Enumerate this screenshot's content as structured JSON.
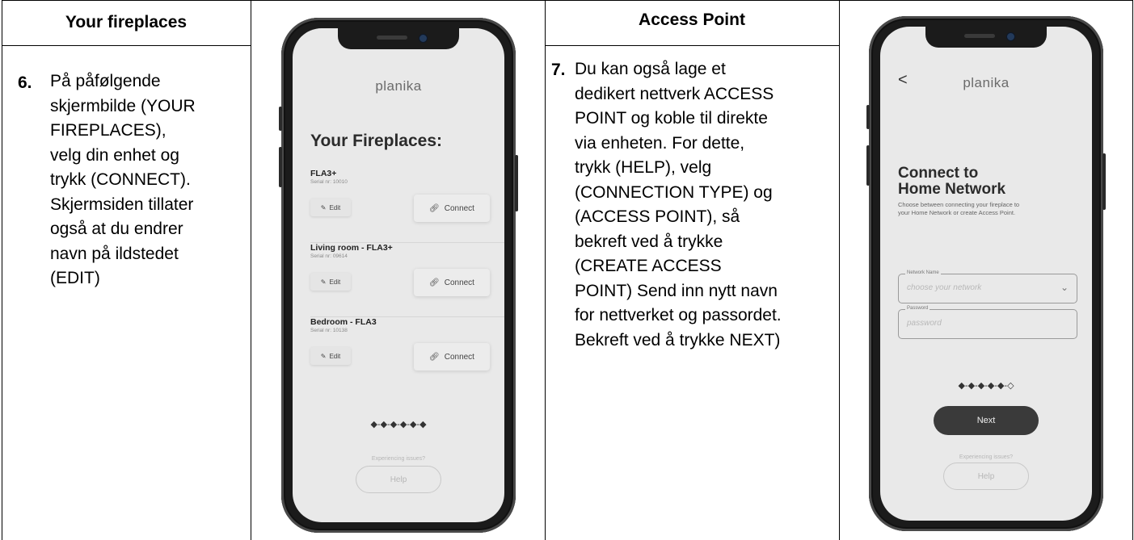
{
  "col1": {
    "header": "Your fireplaces",
    "number": "6.",
    "lines": [
      "På påfølgende",
      "skjermbilde (YOUR",
      "FIREPLACES),",
      "velg din enhet og",
      "trykk (CONNECT).",
      "Skjermsiden tillater",
      "også at du endrer",
      "navn på ildstedet",
      "(EDIT)"
    ]
  },
  "phone1": {
    "brand": "planika",
    "title": "Your Fireplaces:",
    "items": [
      {
        "name": "FLA3+",
        "serial": "Serial nr: 10010",
        "edit": "Edit",
        "connect": "Connect"
      },
      {
        "name": "Living room - FLA3+",
        "serial": "Serial nr: 09614",
        "edit": "Edit",
        "connect": "Connect"
      },
      {
        "name": "Bedroom - FLA3",
        "serial": "Serial nr: 10138",
        "edit": "Edit",
        "connect": "Connect"
      }
    ],
    "progress": "◆-◆-◆-◆-◆-◆",
    "issues": "Experiencing issues?",
    "help": "Help"
  },
  "col3": {
    "header": "Access Point",
    "number": "7.",
    "lines": [
      "Du kan også lage et",
      "dedikert nettverk ACCESS",
      "POINT og koble til direkte",
      "via enheten. For dette,",
      "trykk (HELP), velg",
      "(CONNECTION TYPE) og",
      "(ACCESS POINT), så",
      "bekreft ved å trykke",
      "(CREATE ACCESS",
      "POINT) Send inn nytt navn",
      "for nettverket og passordet.",
      "Bekreft ved å trykke NEXT)"
    ]
  },
  "phone2": {
    "brand": "planika",
    "back": "<",
    "title_line1": "Connect to",
    "title_line2": "Home Network",
    "desc_line1": "Choose between connecting your fireplace to",
    "desc_line2": "your Home Network or create Access Point.",
    "network_label": "Network Name",
    "network_placeholder": "choose your network",
    "password_label": "Password",
    "password_placeholder": "password",
    "progress": "◆-◆-◆-◆-◆-◇",
    "next": "Next",
    "issues": "Experiencing issues?",
    "help": "Help"
  }
}
